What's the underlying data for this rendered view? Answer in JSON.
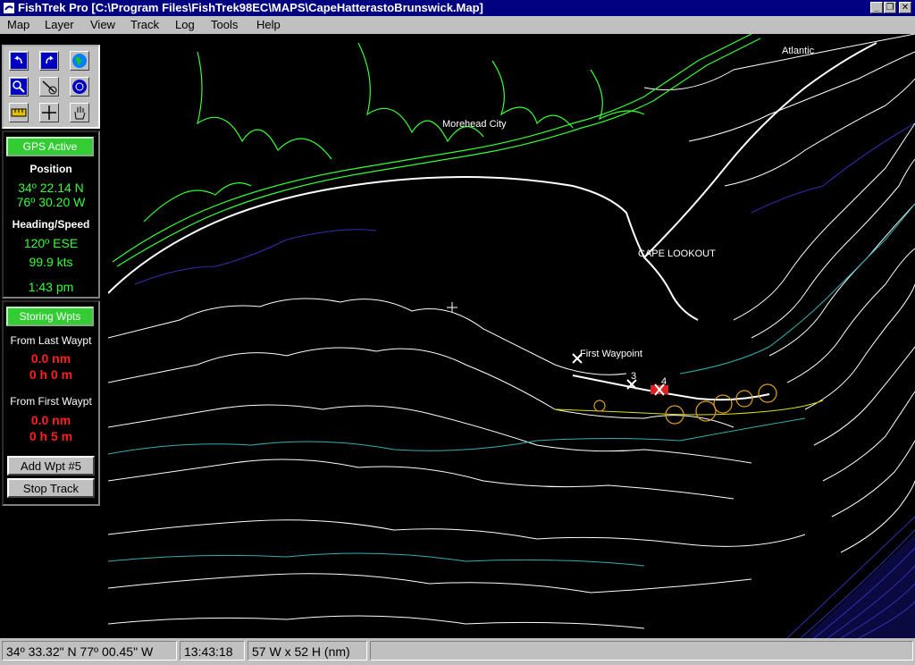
{
  "window": {
    "title": "FishTrek Pro [C:\\Program Files\\FishTrek98EC\\MAPS\\CapeHatterastoBrunswick.Map]"
  },
  "menu": [
    "Map",
    "Layer",
    "View",
    "Track",
    "Log",
    "Tools",
    "Help"
  ],
  "tools": [
    "undo-icon",
    "redo-icon",
    "globe-icon",
    "zoom-icon",
    "measure-icon",
    "target-icon",
    "ruler-icon",
    "crosshair-icon",
    "pan-hand-icon"
  ],
  "gps": {
    "status_button": "GPS Active",
    "position_label": "Position",
    "lat": "34º 22.14 N",
    "lon": "76º 30.20 W",
    "heading_label": "Heading/Speed",
    "heading": "120º ESE",
    "speed": "99.9 kts",
    "time": "1:43 pm"
  },
  "waypoints": {
    "status_button": "Storing Wpts",
    "from_last_label": "From Last Waypt",
    "from_last_dist": "0.0 nm",
    "from_last_time": "0 h 0 m",
    "from_first_label": "From First Waypt",
    "from_first_dist": "0.0 nm",
    "from_first_time": "0 h 5 m",
    "add_button": "Add Wpt #5",
    "stop_button": "Stop Track"
  },
  "map": {
    "labels": {
      "atlantic": "Atlantic",
      "morehead": "Morehead City",
      "cape_lookout": "CAPE LOOKOUT",
      "first_waypoint": "First Waypoint",
      "wpt3": "3",
      "wpt4": "4"
    },
    "colors": {
      "land": "#33ff33",
      "contour": "#ffffff",
      "deep": "#4040c0",
      "shelf": "#40c0c0",
      "track": "#e0e000"
    }
  },
  "status": {
    "cursor": "34º 33.32\" N 77º 00.45\" W",
    "time": "13:43:18",
    "extent": "57 W x 52 H (nm)"
  }
}
